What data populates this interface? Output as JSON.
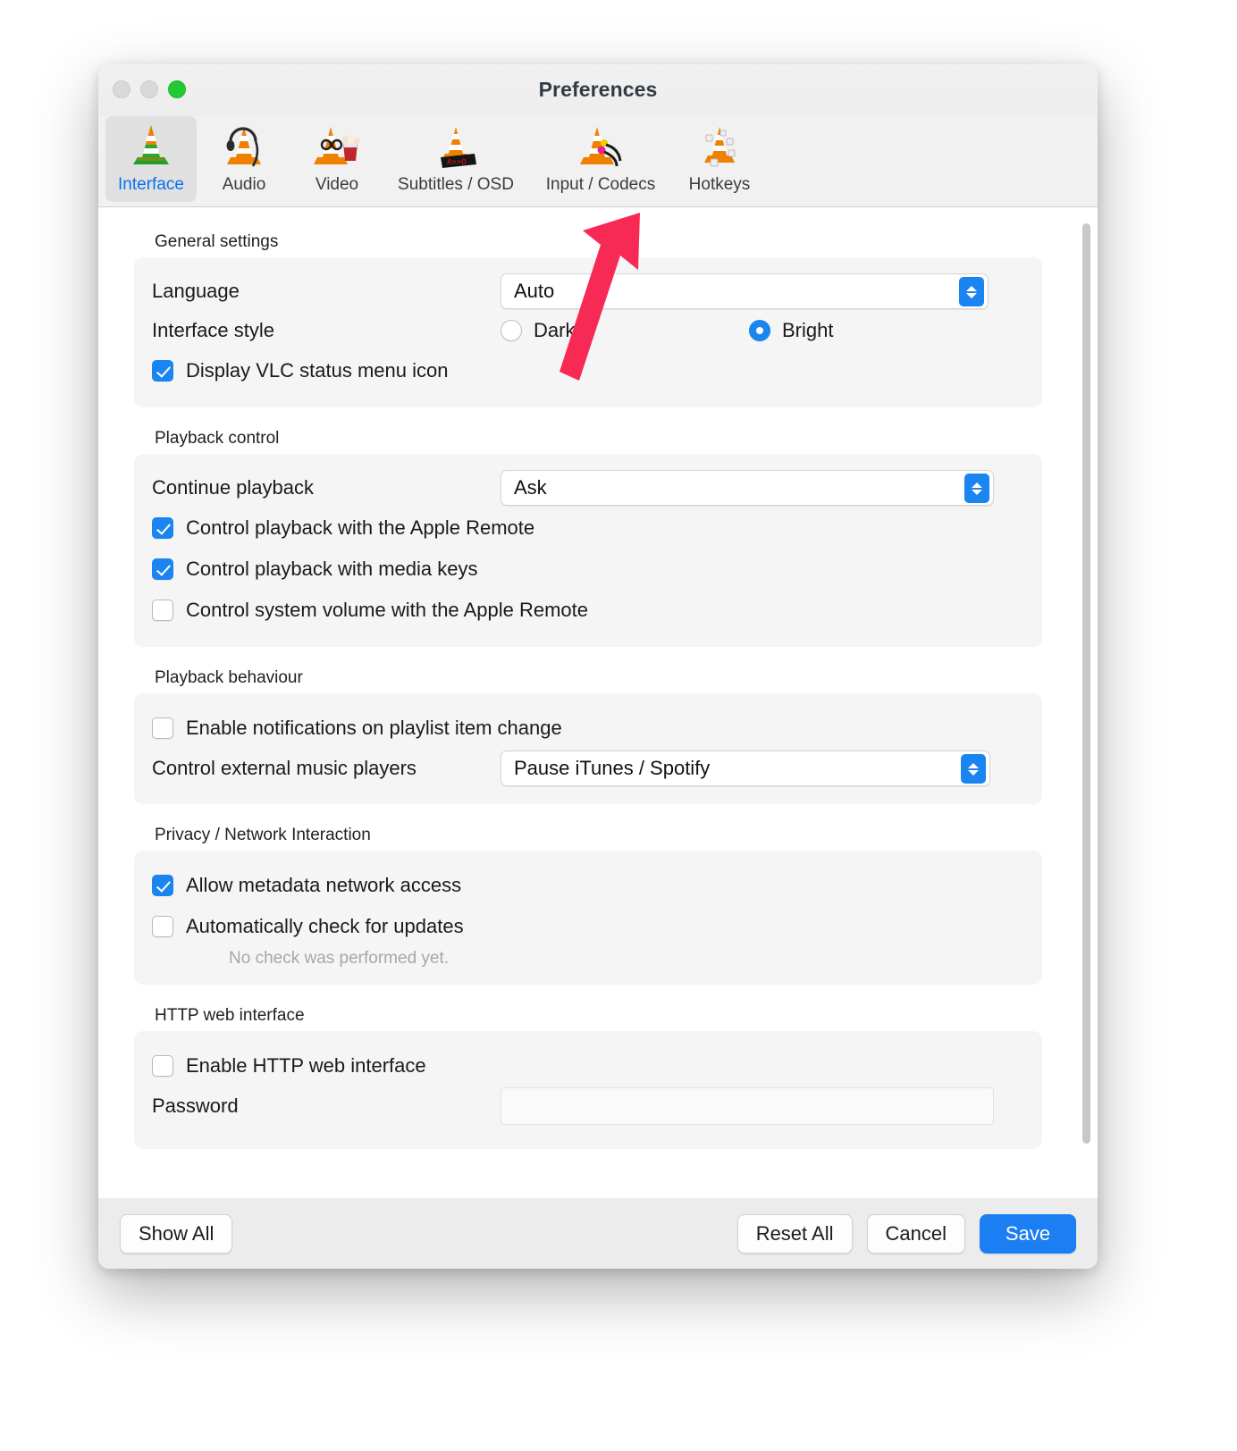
{
  "window": {
    "title": "Preferences",
    "traffic_lights": [
      "close-button",
      "minimize-button",
      "zoom-button"
    ]
  },
  "colors": {
    "accent": "#1a84f0",
    "primary_button": "#1b7ef3",
    "active_tab_text": "#0a6ff0",
    "annotation_arrow": "#f72a55",
    "group_background": "#f5f5f5",
    "window_chrome": "#ececec"
  },
  "toolbar": {
    "items": [
      {
        "label": "Interface",
        "icon": "vlc-cone-icon",
        "active": true
      },
      {
        "label": "Audio",
        "icon": "vlc-cone-headphones-icon",
        "active": false
      },
      {
        "label": "Video",
        "icon": "vlc-cone-popcorn-icon",
        "active": false
      },
      {
        "label": "Subtitles / OSD",
        "icon": "vlc-cone-subtitles-icon",
        "active": false
      },
      {
        "label": "Input / Codecs",
        "icon": "vlc-cone-cables-icon",
        "active": false
      },
      {
        "label": "Hotkeys",
        "icon": "vlc-cone-keys-icon",
        "active": false
      }
    ]
  },
  "sections": {
    "general": {
      "title": "General settings",
      "language_label": "Language",
      "language_value": "Auto",
      "interface_style_label": "Interface style",
      "style_dark_label": "Dark",
      "style_dark_selected": false,
      "style_bright_label": "Bright",
      "style_bright_selected": true,
      "status_menu_label": "Display VLC status menu icon",
      "status_menu_checked": true
    },
    "playback_control": {
      "title": "Playback control",
      "continue_label": "Continue playback",
      "continue_value": "Ask",
      "apple_remote_label": "Control playback with the Apple Remote",
      "apple_remote_checked": true,
      "media_keys_label": "Control playback with media keys",
      "media_keys_checked": true,
      "system_volume_label": "Control system volume with the Apple Remote",
      "system_volume_checked": false
    },
    "playback_behaviour": {
      "title": "Playback behaviour",
      "notifications_label": "Enable notifications on playlist item change",
      "notifications_checked": false,
      "external_players_label": "Control external music players",
      "external_players_value": "Pause iTunes / Spotify"
    },
    "privacy": {
      "title": "Privacy / Network Interaction",
      "metadata_label": "Allow metadata network access",
      "metadata_checked": true,
      "updates_label": "Automatically check for updates",
      "updates_checked": false,
      "update_hint": "No check was performed yet."
    },
    "http": {
      "title": "HTTP web interface",
      "enable_label": "Enable HTTP web interface",
      "enable_checked": false,
      "password_label": "Password",
      "password_value": ""
    }
  },
  "footer": {
    "show_all": "Show All",
    "reset_all": "Reset All",
    "cancel": "Cancel",
    "save": "Save"
  }
}
